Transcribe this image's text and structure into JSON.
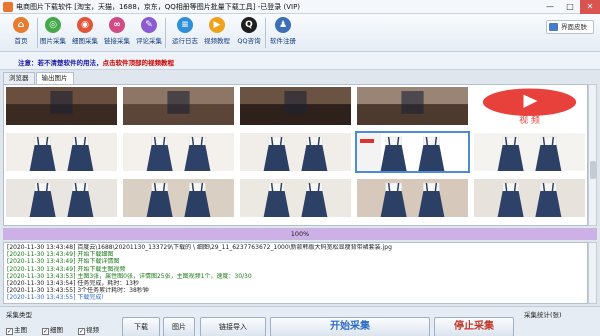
{
  "window": {
    "title": "电商图片下载软件 [淘宝，天猫，1688，京东，QQ相册等图片批量下载工具] -已登录 (VIP)",
    "minimize": "—",
    "maximize": "□",
    "close": "✕"
  },
  "toolbar": {
    "items": [
      {
        "label": "首页",
        "icon": "home-icon",
        "color": "#e87c2e",
        "glyph": "⌂"
      },
      {
        "label": "图片采集",
        "icon": "image-collect-icon",
        "color": "#45a94a",
        "glyph": "◎"
      },
      {
        "label": "细图采集",
        "icon": "detail-collect-icon",
        "color": "#e2553a",
        "glyph": "◉"
      },
      {
        "label": "链接采集",
        "icon": "link-collect-icon",
        "color": "#d24b86",
        "glyph": "∞"
      },
      {
        "label": "评论采集",
        "icon": "comment-collect-icon",
        "color": "#8a5bd1",
        "glyph": "✎"
      },
      {
        "label": "运行日志",
        "icon": "log-icon",
        "color": "#2f8fd8",
        "glyph": "≡"
      },
      {
        "label": "视频教程",
        "icon": "video-icon",
        "color": "#f0a21c",
        "glyph": "▶"
      },
      {
        "label": "QQ咨询",
        "icon": "qq-icon",
        "color": "#1f1f1f",
        "glyph": "Q"
      },
      {
        "label": "软件注册",
        "icon": "register-icon",
        "color": "#3c6fb8",
        "glyph": "♟"
      }
    ],
    "skin_label": "界面皮肤"
  },
  "notice": {
    "prefix": "注意：",
    "text": "若不清楚软件的用法，",
    "highlight": "点击软件顶部的视频教程"
  },
  "tabs": [
    {
      "label": "浏览器",
      "active": false
    },
    {
      "label": "输出图片",
      "active": true
    }
  ],
  "gallery": {
    "thumbnails": [
      {
        "kind": "floor",
        "colors": [
          "#3b2a22",
          "#6a4f3e"
        ]
      },
      {
        "kind": "floor",
        "colors": [
          "#5a4538",
          "#8d7666"
        ]
      },
      {
        "kind": "floor",
        "colors": [
          "#2e211b",
          "#6b5344"
        ]
      },
      {
        "kind": "floor",
        "colors": [
          "#4d3a2f",
          "#9a8475"
        ]
      },
      {
        "kind": "video",
        "colors": [
          "#e8413b",
          "#ffffff"
        ],
        "label": "视 频"
      },
      {
        "kind": "dress",
        "colors": [
          "#f2efea",
          "#2c3f64"
        ]
      },
      {
        "kind": "dress",
        "colors": [
          "#f4f1ec",
          "#2e4168"
        ]
      },
      {
        "kind": "dress",
        "colors": [
          "#f1eee9",
          "#2b3e63"
        ]
      },
      {
        "kind": "dress-red",
        "colors": [
          "#ffffff",
          "#2c3f64"
        ]
      },
      {
        "kind": "dress",
        "colors": [
          "#f5f3ef",
          "#2d4066"
        ]
      },
      {
        "kind": "dress",
        "colors": [
          "#e9e6e1",
          "#2c3f64"
        ]
      },
      {
        "kind": "dress",
        "colors": [
          "#d9cfc3",
          "#2b3e63"
        ]
      },
      {
        "kind": "dress",
        "colors": [
          "#ece8e2",
          "#2d4066"
        ]
      },
      {
        "kind": "dress",
        "colors": [
          "#d6c9bb",
          "#2c3f64"
        ]
      },
      {
        "kind": "dress",
        "colors": [
          "#e7e2db",
          "#2e4168"
        ]
      }
    ],
    "selected_index": 8
  },
  "progress": {
    "value": 1.0,
    "label": "100%"
  },
  "log": {
    "lines": [
      {
        "text": "[2020-11-30 13:43:48] 百度云\\1688\\20201130_133729\\下载的 \\ 细图\\29_11_6237763672_1000\\新款韩版大码宽松显瘦背带裙套装.jpg",
        "color": "#222"
      },
      {
        "text": "[2020-11-30 13:43:49] 开始下载细图",
        "color": "#1a7a1a"
      },
      {
        "text": "[2020-11-30 13:43:49] 开始下载详情图",
        "color": "#1a7a1a"
      },
      {
        "text": "[2020-11-30 13:43:49] 开始下载主图视频",
        "color": "#1a7a1a"
      },
      {
        "text": "[2020-11-30 13:43:53] 主图3张，属性图0张，详情图25张，主图视频1个，速度：30/30",
        "color": "#1a7a1a"
      },
      {
        "text": "[2020-11-30 13:43:54] 任务完成，耗时：13秒",
        "color": "#222"
      },
      {
        "text": "[2020-11-30 13:43:55] 3个任务累计耗时：38秒钟",
        "color": "#222"
      },
      {
        "text": "[2020-11-30 13:43:55] 下载完成!",
        "color": "#2d6bc4"
      }
    ]
  },
  "bottom": {
    "collect_type_title": "采集类型",
    "checks": [
      {
        "label": "主图",
        "checked": true
      },
      {
        "label": "细图",
        "checked": true
      },
      {
        "label": "视频",
        "checked": true
      }
    ],
    "buttons": {
      "download": "下载",
      "images": "图片",
      "link": "链接导入",
      "start": "开始采集",
      "stop": "停止采集"
    },
    "stats_title": "采集统计(张)"
  }
}
